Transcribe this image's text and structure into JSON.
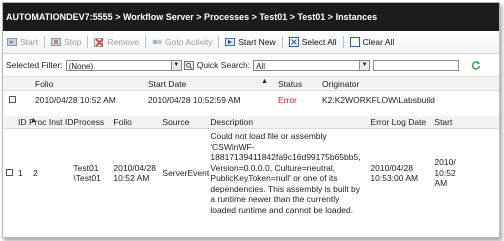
{
  "breadcrumb": "AUTOMATIONDEV7:5555 > Workflow Server > Processes > Test01 > Test01 > Instances",
  "toolbar": {
    "start": "Start",
    "stop": "Stop",
    "remove": "Remove",
    "goto_activity": "Goto Activity",
    "start_new": "Start New",
    "select_all": "Select All",
    "clear_all": "Clear All"
  },
  "filter": {
    "selected_label": "Selected Filter:",
    "selected_value": "(None)",
    "quick_search_label": "Quick Search:",
    "quick_search_value": "All",
    "search_text": ""
  },
  "instances": {
    "headers": {
      "folio": "Folio",
      "start_date": "Start Date",
      "status": "Status",
      "originator": "Originator"
    },
    "rows": [
      {
        "folio": "2010/04/28 10:52 AM",
        "start_date": "2010/04/28 10:52:59 AM",
        "status": "Error",
        "originator": "K2:K2WORKFLOW\\Labsbuild"
      }
    ]
  },
  "errors": {
    "headers": {
      "id": "ID",
      "proc_inst_id": "Proc Inst ID",
      "process": "Process",
      "folio": "Folio",
      "source": "Source",
      "description": "Description",
      "error_log_date": "Error Log Date",
      "start": "Start"
    },
    "rows": [
      {
        "id": "1",
        "proc_inst_id": "2",
        "process_1": "Test01",
        "process_2": "\\Test01",
        "folio_1": "2010/04/28",
        "folio_2": "10:52 AM",
        "source": "ServerEvent",
        "description": [
          "Could not load file or assembly",
          "'CSWinWF-",
          "18817139411842fa9c16d99175b65bb5,",
          "Version=0.0.0.0, Culture=neutral,",
          "PublicKeyToken=null' or one of its",
          "dependencies. This assembly is built by",
          "a runtime newer than the currently",
          "loaded runtime and cannot be loaded."
        ],
        "error_log_date_1": "2010/04/28",
        "error_log_date_2": "10:53:00 AM",
        "start_1": "2010/",
        "start_2": "10:52",
        "start_3": "AM"
      }
    ]
  },
  "colors": {
    "titlebar": "#1b1b1b",
    "error": "#d42020",
    "refresh": "#2fa84f"
  }
}
